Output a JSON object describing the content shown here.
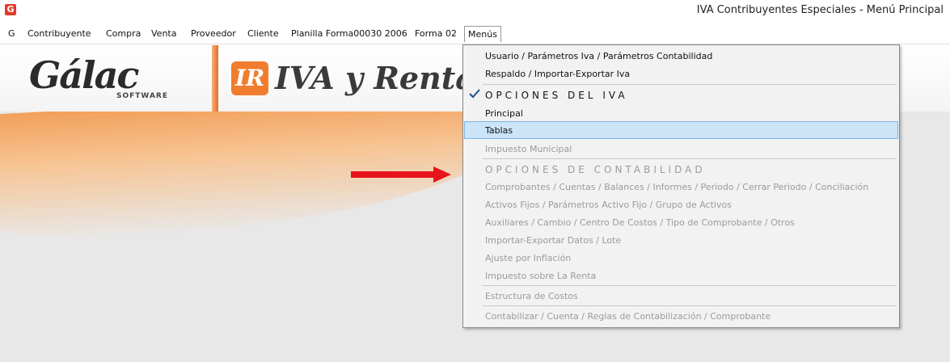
{
  "window": {
    "title": "IVA Contribuyentes Especiales - Menú Principal",
    "app_icon": "G"
  },
  "menubar": {
    "items": [
      "G",
      "Contribuyente",
      "Compra",
      "Venta",
      "Proveedor",
      "Cliente",
      "Planilla Forma00030 2006",
      "Forma 02",
      "Menús"
    ],
    "active": "Menús"
  },
  "banner": {
    "brand": "Gálac",
    "tagline": "SOFTWARE",
    "badge": "IR",
    "product": "IVA y Renta"
  },
  "dropdown": {
    "items": [
      {
        "label": "Usuario / Parámetros Iva / Parámetros Contabilidad",
        "enabled": true
      },
      {
        "label": "Respaldo / Importar-Exportar Iva",
        "enabled": true
      },
      {
        "label": "OPCIONES DEL IVA",
        "enabled": true,
        "checked": true,
        "section": true
      },
      {
        "label": "Principal",
        "enabled": true
      },
      {
        "label": "Tablas",
        "enabled": true,
        "highlighted": true
      },
      {
        "label": "Impuesto Municipal",
        "enabled": false
      },
      {
        "label": "OPCIONES DE CONTABILIDAD",
        "enabled": false,
        "section": true
      },
      {
        "label": "Comprobantes / Cuentas / Balances / Informes / Periodo / Cerrar Periodo / Conciliación",
        "enabled": false
      },
      {
        "label": "Activos Fijos / Parámetros Activo Fijo / Grupo de Activos",
        "enabled": false
      },
      {
        "label": "Auxiliares / Cambio / Centro De Costos / Tipo de Comprobante / Otros",
        "enabled": false
      },
      {
        "label": "Importar-Exportar Datos / Lote",
        "enabled": false
      },
      {
        "label": "Ajuste por Inflación",
        "enabled": false
      },
      {
        "label": "Impuesto sobre La Renta",
        "enabled": false
      },
      {
        "label": "Estructura de Costos",
        "enabled": false
      },
      {
        "label": "Contabilizar / Cuenta / Reglas de Contabilización / Comprobante",
        "enabled": false
      }
    ]
  },
  "annotation": {
    "arrow_color": "#e8141b",
    "icon": "red-arrow-right-icon"
  },
  "colors": {
    "highlight": "#cce4f7",
    "accent_orange": "#f07d2e",
    "disabled_text": "#9b9b9b"
  }
}
